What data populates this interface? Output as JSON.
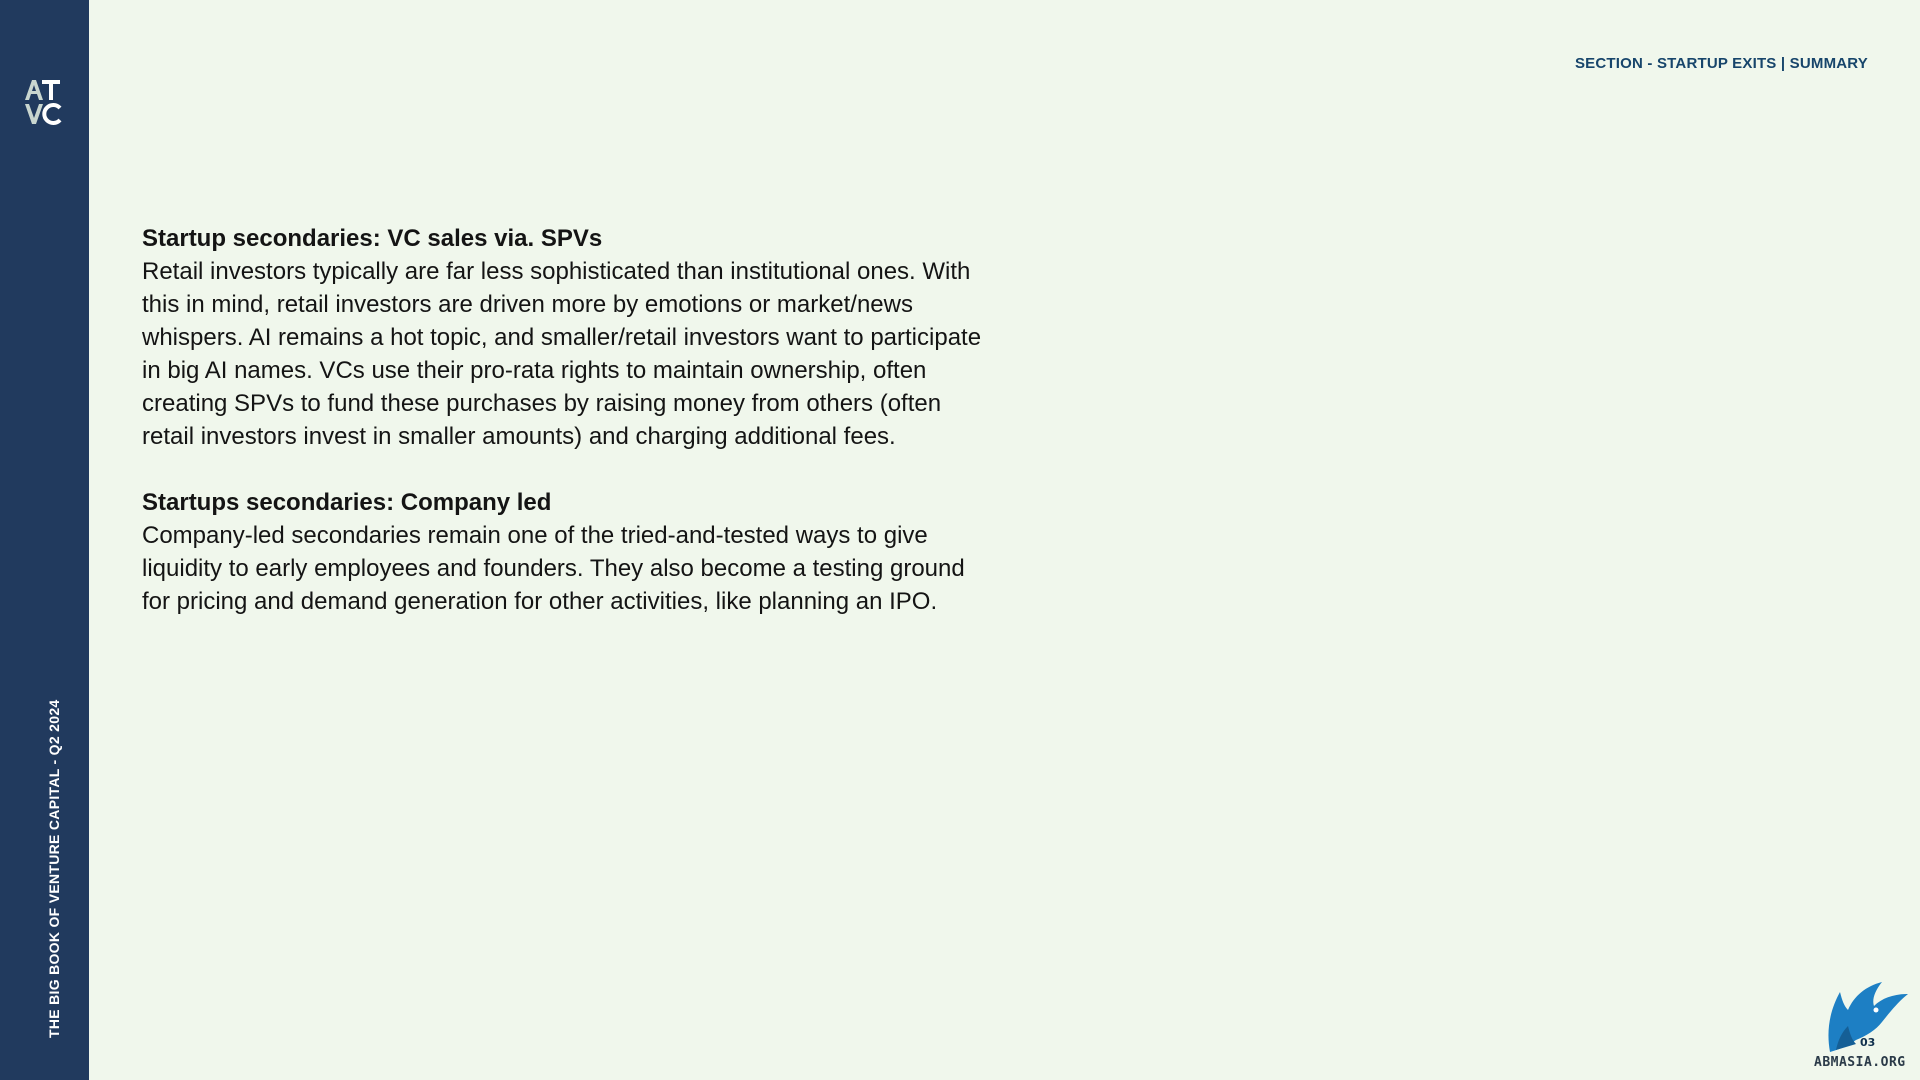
{
  "sidebar": {
    "logo_text": "AT VC",
    "vertical_title": "THE BIG BOOK OF VENTURE CAPITAL - Q2 2024"
  },
  "header": {
    "breadcrumb": "SECTION - STARTUP EXITS | SUMMARY"
  },
  "sections": [
    {
      "heading": "Startup secondaries: VC sales via. SPVs",
      "body": "Retail investors typically are far less sophisticated than institutional ones. With this in mind, retail investors are driven more by emotions or market/news whispers. AI remains a hot topic, and smaller/retail investors want to participate in big AI names. VCs use their pro-rata rights to maintain ownership, often creating SPVs to fund these purchases by raising money from others (often retail investors invest in smaller amounts) and charging additional fees."
    },
    {
      "heading": "Startups secondaries: Company led",
      "body": "Company-led secondaries remain one of the tried-and-tested ways to give liquidity to early employees and founders. They also become a testing ground for pricing and demand generation for other activities, like planning an IPO."
    }
  ],
  "watermark": {
    "text": "ABMASIA.ORG",
    "badge": "03"
  },
  "colors": {
    "background": "#f0f7ec",
    "sidebar": "#213a5e",
    "header_text": "#17456b",
    "body_text": "#141414",
    "watermark_blue": "#1d7fc4"
  }
}
